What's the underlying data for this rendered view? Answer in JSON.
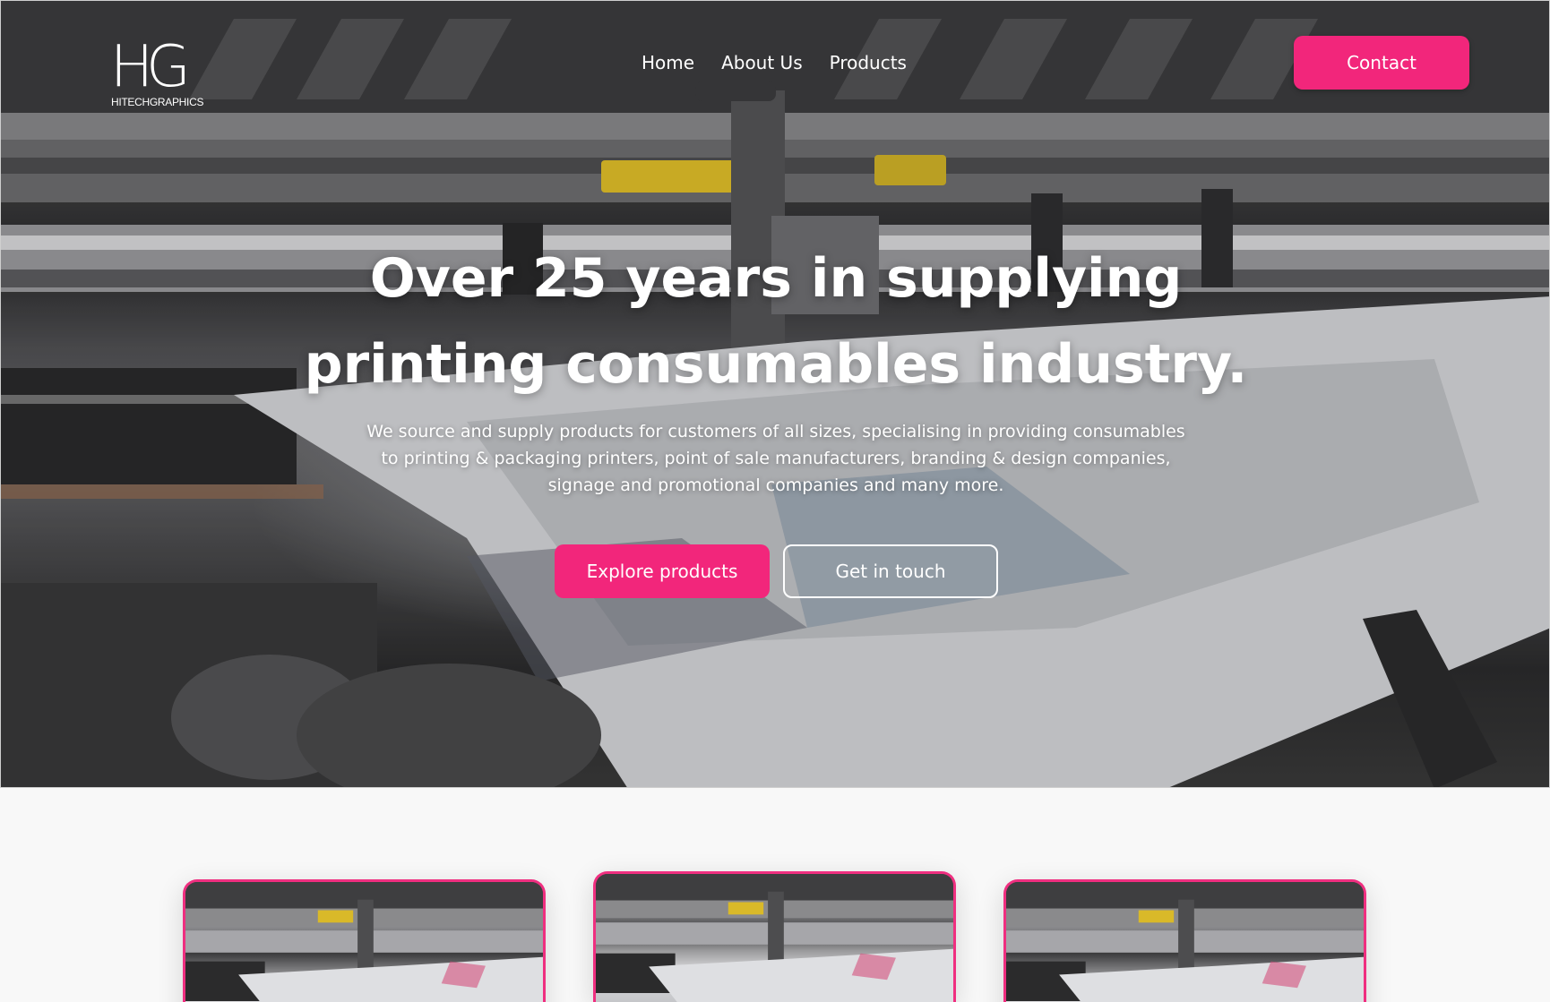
{
  "header": {
    "logo_mark": "HG",
    "logo_text": "HITECHGRAPHICS",
    "nav": [
      "Home",
      "About Us",
      "Products"
    ],
    "contact_label": "Contact"
  },
  "hero": {
    "headline_line1": "Over 25 years in supplying",
    "headline_line2": "printing consumables industry.",
    "subcopy_line1": "We source and supply products for customers of all sizes, specialising in providing consumables",
    "subcopy_line2": "to printing & packaging printers, point of sale manufacturers, branding & design companies,",
    "subcopy_line3": "signage and promotional companies and many more.",
    "primary_cta": "Explore products",
    "secondary_cta": "Get in touch",
    "background_image": "printing-press-photo"
  },
  "cards": {
    "count": 3,
    "image": "printing-press-thumbnail"
  },
  "colors": {
    "accent": "#f2267b",
    "page_background": "#f8f8f8",
    "text_on_hero": "#ffffff"
  }
}
